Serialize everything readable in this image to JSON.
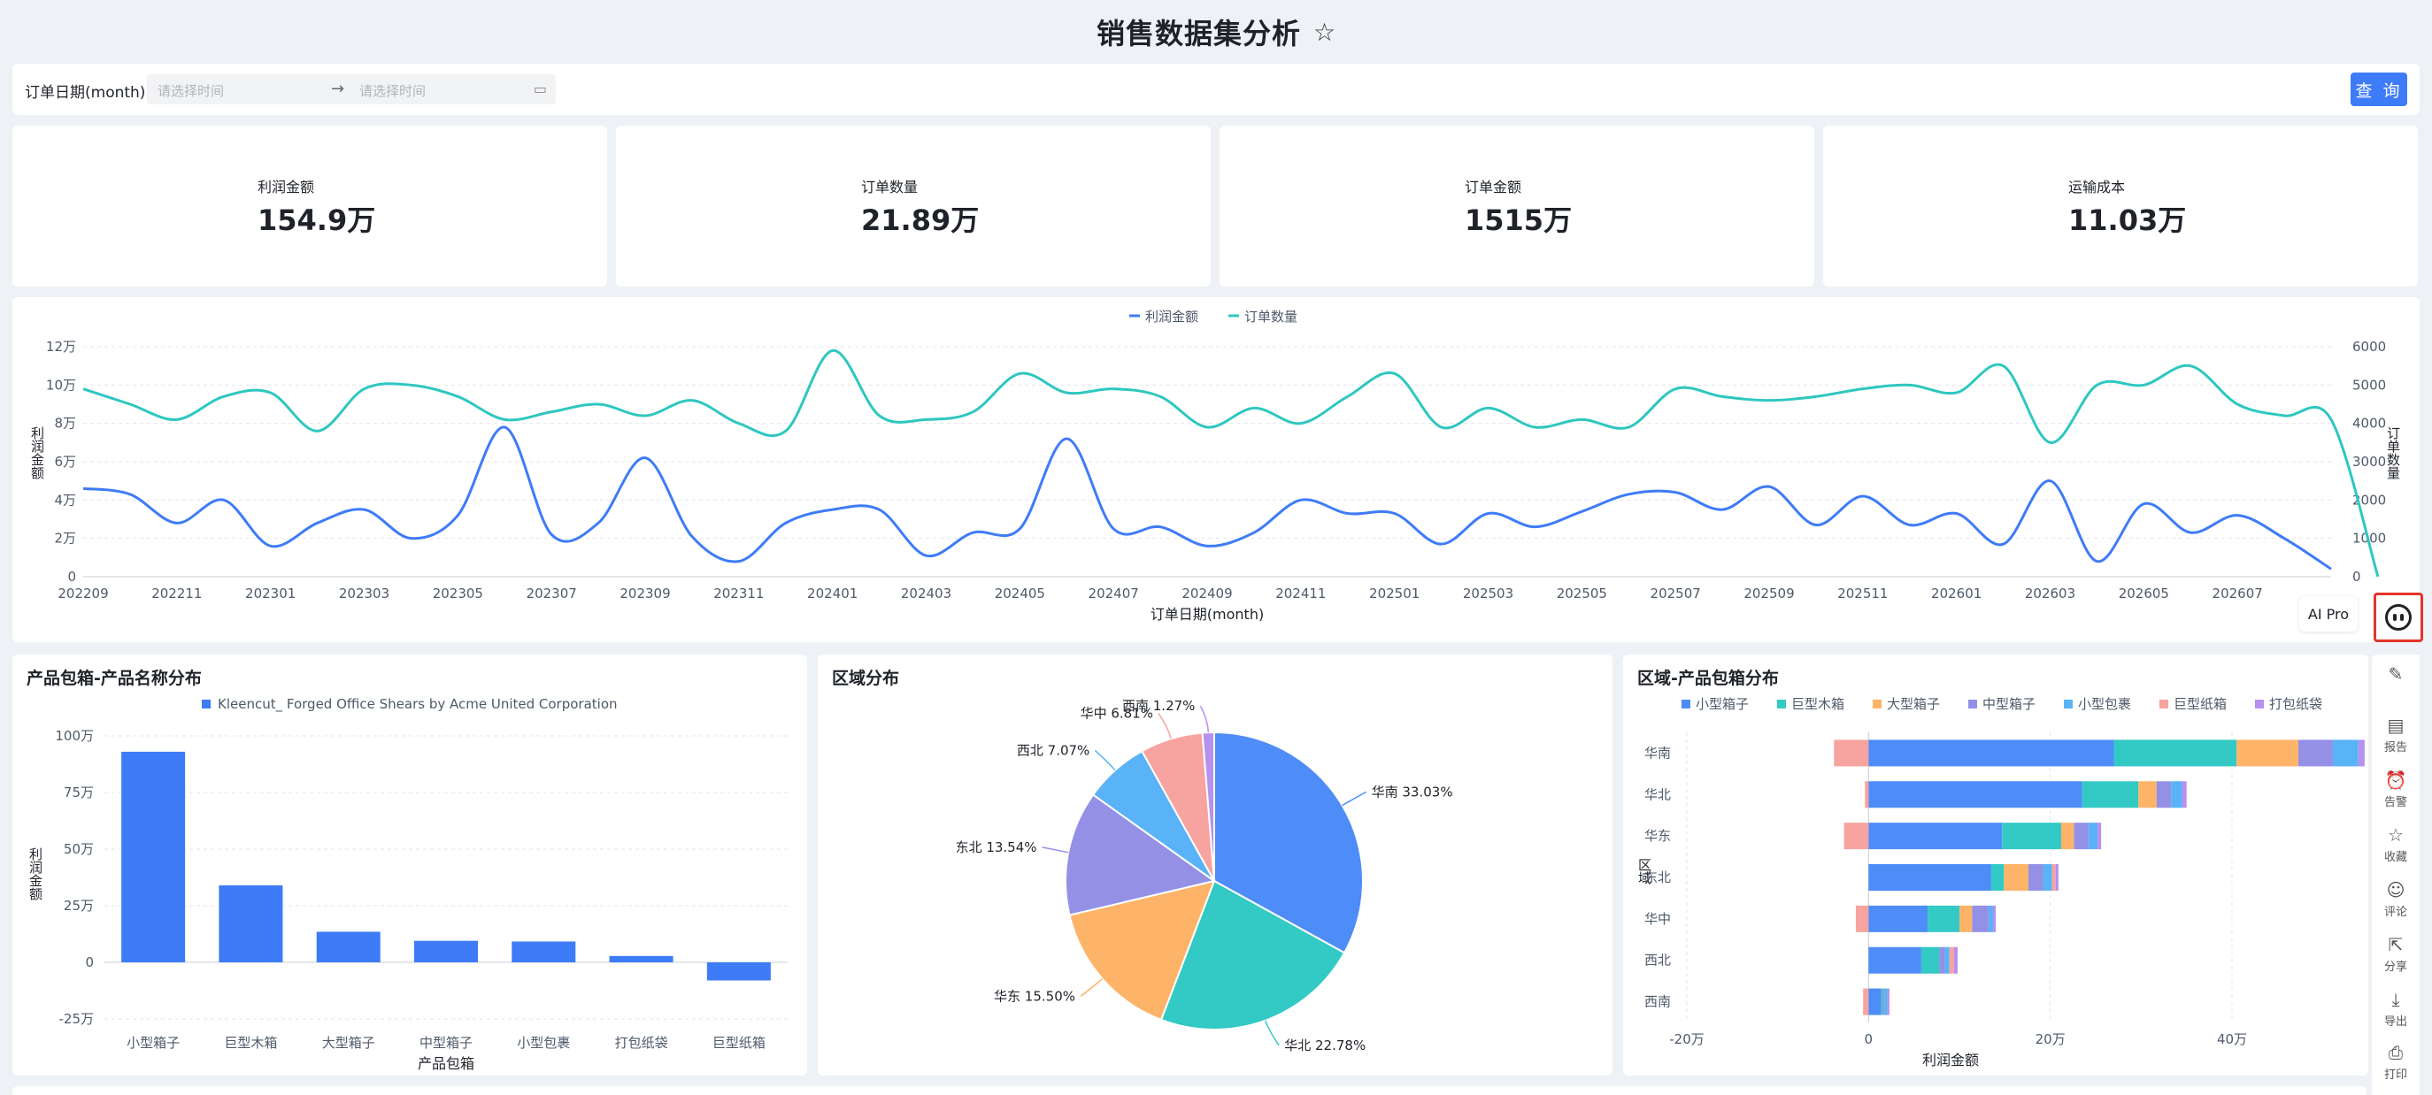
{
  "header": {
    "title": "销售数据集分析",
    "star_icon": "star-icon"
  },
  "filter": {
    "label": "订单日期(month)",
    "start_placeholder": "请选择时间",
    "end_placeholder": "请选择时间",
    "query_label": "查 询"
  },
  "kpis": [
    {
      "label": "利润金额",
      "value": "154.9万"
    },
    {
      "label": "订单数量",
      "value": "21.89万"
    },
    {
      "label": "订单金额",
      "value": "1515万"
    },
    {
      "label": "运输成本",
      "value": "11.03万"
    }
  ],
  "sidebar": {
    "ai_label": "AI Pro",
    "items": [
      {
        "label": "",
        "icon": "edit-icon"
      },
      {
        "label": "报告",
        "icon": "report-icon"
      },
      {
        "label": "告警",
        "icon": "alarm-icon"
      },
      {
        "label": "收藏",
        "icon": "star-icon"
      },
      {
        "label": "评论",
        "icon": "comment-icon"
      },
      {
        "label": "分享",
        "icon": "share-icon"
      },
      {
        "label": "导出",
        "icon": "export-icon"
      },
      {
        "label": "打印",
        "icon": "print-icon"
      }
    ]
  },
  "chart_data": [
    {
      "type": "line",
      "title": "",
      "legend": [
        "利润金额",
        "订单数量"
      ],
      "colors": [
        "#3e7bf7",
        "#2ec7c0"
      ],
      "xlabel": "订单日期(month)",
      "ylabel_left": "利润金额",
      "ylabel_right": "订单数量",
      "x": [
        "202209",
        "202210",
        "202211",
        "202212",
        "202301",
        "202302",
        "202303",
        "202304",
        "202305",
        "202306",
        "202307",
        "202308",
        "202309",
        "202310",
        "202311",
        "202312",
        "202401",
        "202402",
        "202403",
        "202404",
        "202405",
        "202406",
        "202407",
        "202408",
        "202409",
        "202410",
        "202411",
        "202412",
        "202501",
        "202502",
        "202503",
        "202504",
        "202505",
        "202506",
        "202507",
        "202508",
        "202509",
        "202510",
        "202511",
        "202512",
        "202601",
        "202602",
        "202603",
        "202604",
        "202605",
        "202606",
        "202607",
        "202608"
      ],
      "x_tick_labels": [
        "202209",
        "202211",
        "202301",
        "202303",
        "202305",
        "202307",
        "202309",
        "202311",
        "202401",
        "202403",
        "202405",
        "202407",
        "202409",
        "202411",
        "202501",
        "202503",
        "202505",
        "202507",
        "202509",
        "202511",
        "202601",
        "202603",
        "202605",
        "202607"
      ],
      "y_left_ticks": [
        "0",
        "2万",
        "4万",
        "6万",
        "8万",
        "10万",
        "12万"
      ],
      "y_right_ticks": [
        "0",
        "1000",
        "2000",
        "3000",
        "4000",
        "5000",
        "6000"
      ],
      "ylim_left": [
        0,
        120000
      ],
      "ylim_right": [
        0,
        6000
      ],
      "series": [
        {
          "name": "利润金额",
          "axis": "left",
          "values": [
            46000,
            43000,
            28000,
            40000,
            16000,
            28000,
            35000,
            20000,
            32000,
            78000,
            22000,
            28000,
            62000,
            21000,
            8000,
            28000,
            35000,
            35000,
            11000,
            23000,
            25000,
            72000,
            25000,
            26000,
            16000,
            23000,
            40000,
            33000,
            33000,
            17000,
            33000,
            26000,
            34000,
            43000,
            44000,
            35000,
            47000,
            27000,
            42000,
            27000,
            33000,
            17000,
            50000,
            8000,
            38000,
            23000,
            32000,
            20000,
            4000
          ],
          "note_ignore": ""
        },
        {
          "name": "订单数量",
          "axis": "right",
          "values": [
            4900,
            4500,
            4100,
            4700,
            4800,
            3800,
            4900,
            5000,
            4700,
            4100,
            4300,
            4500,
            4200,
            4600,
            4000,
            3800,
            5900,
            4200,
            4100,
            4300,
            5300,
            4800,
            4900,
            4700,
            3900,
            4400,
            4000,
            4700,
            5300,
            3900,
            4400,
            3900,
            4100,
            3900,
            4900,
            4700,
            4600,
            4700,
            4900,
            5000,
            4800,
            5500,
            3500,
            5000,
            5000,
            5500,
            4500,
            4200,
            4100,
            0
          ]
        }
      ]
    },
    {
      "type": "bar",
      "title": "产品包箱-产品名称分布",
      "legend": [
        "Kleencut_ Forged Office Shears by Acme United Corporation"
      ],
      "colors": [
        "#3e7bf7"
      ],
      "xlabel": "产品包箱",
      "ylabel": "利润金额",
      "categories": [
        "小型箱子",
        "巨型木箱",
        "大型箱子",
        "中型箱子",
        "小型包裹",
        "打包纸袋",
        "巨型纸箱"
      ],
      "values": [
        930000,
        340000,
        135000,
        95000,
        92000,
        28000,
        -80000
      ],
      "y_ticks": [
        "-25万",
        "0",
        "25万",
        "50万",
        "75万",
        "100万"
      ],
      "ylim": [
        -250000,
        1000000
      ]
    },
    {
      "type": "pie",
      "title": "区域分布",
      "slices": [
        {
          "name": "华南",
          "value": 33.03,
          "label": "华南 33.03%",
          "color": "#4e8cf8"
        },
        {
          "name": "华北",
          "value": 22.78,
          "label": "华北 22.78%",
          "color": "#33c9c5"
        },
        {
          "name": "华东",
          "value": 15.5,
          "label": "华东 15.50%",
          "color": "#fdb469"
        },
        {
          "name": "东北",
          "value": 13.54,
          "label": "东北 13.54%",
          "color": "#9490e6"
        },
        {
          "name": "西北",
          "value": 7.07,
          "label": "西北 7.07%",
          "color": "#59b3f6"
        },
        {
          "name": "华中",
          "value": 6.81,
          "label": "华中 6.81%",
          "color": "#f7a39f"
        },
        {
          "name": "西南",
          "value": 1.27,
          "label": "西南 1.27%",
          "color": "#b691ee"
        }
      ]
    },
    {
      "type": "bar",
      "orientation": "horizontal-stacked",
      "title": "区域-产品包箱分布",
      "xlabel": "利润金额",
      "ylabel": "区域",
      "categories": [
        "华南",
        "华北",
        "华东",
        "东北",
        "华中",
        "西北",
        "西南"
      ],
      "x_ticks": [
        "-20万",
        "0",
        "20万",
        "40万"
      ],
      "xlim": [
        -200000,
        550000
      ],
      "series": [
        {
          "name": "小型箱子",
          "color": "#4e8cf8",
          "values": [
            270000,
            235000,
            147000,
            135000,
            65000,
            58000,
            14000
          ]
        },
        {
          "name": "巨型木箱",
          "color": "#33c9c5",
          "values": [
            135000,
            62000,
            65000,
            14000,
            35000,
            20000,
            2000
          ]
        },
        {
          "name": "大型箱子",
          "color": "#fdb469",
          "values": [
            68000,
            20000,
            14000,
            27000,
            14000,
            0,
            0
          ]
        },
        {
          "name": "中型箱子",
          "color": "#9490e6",
          "values": [
            38000,
            16000,
            16000,
            16000,
            18000,
            6000,
            2000
          ]
        },
        {
          "name": "小型包裹",
          "color": "#59b3f6",
          "values": [
            28000,
            12000,
            10000,
            10000,
            5000,
            5000,
            3000
          ]
        },
        {
          "name": "巨型纸箱",
          "color": "#f7a39f",
          "values": [
            -38000,
            -4000,
            -27000,
            4000,
            -14000,
            5000,
            -6000
          ]
        },
        {
          "name": "打包纸袋",
          "color": "#b691ee",
          "values": [
            7000,
            5000,
            4000,
            3000,
            3000,
            4000,
            2000
          ]
        }
      ]
    }
  ]
}
